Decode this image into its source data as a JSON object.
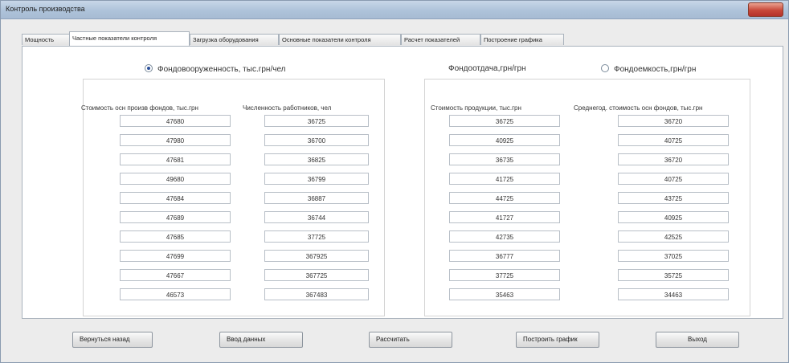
{
  "window": {
    "title": "Контроль производства"
  },
  "tabs": [
    "Мощность",
    "Частные показатели контроля",
    "Загрузка оборудования",
    "Основные показатели контроля",
    "Расчет показателей",
    "Построение графика"
  ],
  "active_tab": 1,
  "radios": {
    "fondovooruzhennost": {
      "label": "Фондовооруженность, тыс.грн/чел",
      "selected": true
    },
    "fondootdacha": {
      "label": "Фондоотдача,грн/грн"
    },
    "fondoemkost": {
      "label": "Фондоемкость,грн/грн",
      "selected": false
    }
  },
  "left_group": {
    "col1_header": "Стоимость осн произв фондов, тыс.грн",
    "col2_header": "Численность работников, чел",
    "col1_values": [
      "47680",
      "47980",
      "47681",
      "49680",
      "47684",
      "47689",
      "47685",
      "47699",
      "47667",
      "46573"
    ],
    "col2_values": [
      "36725",
      "36700",
      "36825",
      "36799",
      "36887",
      "36744",
      "37725",
      "367925",
      "367725",
      "367483"
    ]
  },
  "right_group": {
    "col1_header": "Стоимость продукции, тыс.грн",
    "col2_header": "Среднегод. стоимость осн фондов, тыс.грн",
    "col1_values": [
      "36725",
      "40925",
      "36735",
      "41725",
      "44725",
      "41727",
      "42735",
      "36777",
      "37725",
      "35463"
    ],
    "col2_values": [
      "36720",
      "40725",
      "36720",
      "40725",
      "43725",
      "40925",
      "42525",
      "37025",
      "35725",
      "34463"
    ]
  },
  "buttons": {
    "back": "Вернуться назад",
    "input": "Ввод данных",
    "calculate": "Рассчитать",
    "plot": "Построить график",
    "exit": "Выход"
  },
  "colors": {
    "titlebar": "#aec3da",
    "close": "#c8483a",
    "radio_dot": "#2a4f9a"
  }
}
